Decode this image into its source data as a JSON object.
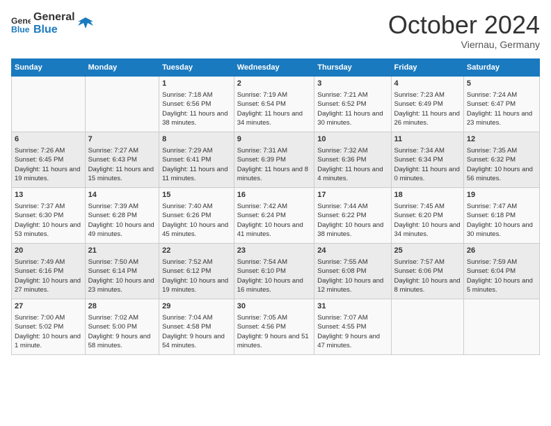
{
  "logo": {
    "line1": "General",
    "line2": "Blue"
  },
  "title": "October 2024",
  "location": "Viernau, Germany",
  "headers": [
    "Sunday",
    "Monday",
    "Tuesday",
    "Wednesday",
    "Thursday",
    "Friday",
    "Saturday"
  ],
  "rows": [
    [
      {
        "day": "",
        "info": ""
      },
      {
        "day": "",
        "info": ""
      },
      {
        "day": "1",
        "info": "Sunrise: 7:18 AM\nSunset: 6:56 PM\nDaylight: 11 hours and 38 minutes."
      },
      {
        "day": "2",
        "info": "Sunrise: 7:19 AM\nSunset: 6:54 PM\nDaylight: 11 hours and 34 minutes."
      },
      {
        "day": "3",
        "info": "Sunrise: 7:21 AM\nSunset: 6:52 PM\nDaylight: 11 hours and 30 minutes."
      },
      {
        "day": "4",
        "info": "Sunrise: 7:23 AM\nSunset: 6:49 PM\nDaylight: 11 hours and 26 minutes."
      },
      {
        "day": "5",
        "info": "Sunrise: 7:24 AM\nSunset: 6:47 PM\nDaylight: 11 hours and 23 minutes."
      }
    ],
    [
      {
        "day": "6",
        "info": "Sunrise: 7:26 AM\nSunset: 6:45 PM\nDaylight: 11 hours and 19 minutes."
      },
      {
        "day": "7",
        "info": "Sunrise: 7:27 AM\nSunset: 6:43 PM\nDaylight: 11 hours and 15 minutes."
      },
      {
        "day": "8",
        "info": "Sunrise: 7:29 AM\nSunset: 6:41 PM\nDaylight: 11 hours and 11 minutes."
      },
      {
        "day": "9",
        "info": "Sunrise: 7:31 AM\nSunset: 6:39 PM\nDaylight: 11 hours and 8 minutes."
      },
      {
        "day": "10",
        "info": "Sunrise: 7:32 AM\nSunset: 6:36 PM\nDaylight: 11 hours and 4 minutes."
      },
      {
        "day": "11",
        "info": "Sunrise: 7:34 AM\nSunset: 6:34 PM\nDaylight: 11 hours and 0 minutes."
      },
      {
        "day": "12",
        "info": "Sunrise: 7:35 AM\nSunset: 6:32 PM\nDaylight: 10 hours and 56 minutes."
      }
    ],
    [
      {
        "day": "13",
        "info": "Sunrise: 7:37 AM\nSunset: 6:30 PM\nDaylight: 10 hours and 53 minutes."
      },
      {
        "day": "14",
        "info": "Sunrise: 7:39 AM\nSunset: 6:28 PM\nDaylight: 10 hours and 49 minutes."
      },
      {
        "day": "15",
        "info": "Sunrise: 7:40 AM\nSunset: 6:26 PM\nDaylight: 10 hours and 45 minutes."
      },
      {
        "day": "16",
        "info": "Sunrise: 7:42 AM\nSunset: 6:24 PM\nDaylight: 10 hours and 41 minutes."
      },
      {
        "day": "17",
        "info": "Sunrise: 7:44 AM\nSunset: 6:22 PM\nDaylight: 10 hours and 38 minutes."
      },
      {
        "day": "18",
        "info": "Sunrise: 7:45 AM\nSunset: 6:20 PM\nDaylight: 10 hours and 34 minutes."
      },
      {
        "day": "19",
        "info": "Sunrise: 7:47 AM\nSunset: 6:18 PM\nDaylight: 10 hours and 30 minutes."
      }
    ],
    [
      {
        "day": "20",
        "info": "Sunrise: 7:49 AM\nSunset: 6:16 PM\nDaylight: 10 hours and 27 minutes."
      },
      {
        "day": "21",
        "info": "Sunrise: 7:50 AM\nSunset: 6:14 PM\nDaylight: 10 hours and 23 minutes."
      },
      {
        "day": "22",
        "info": "Sunrise: 7:52 AM\nSunset: 6:12 PM\nDaylight: 10 hours and 19 minutes."
      },
      {
        "day": "23",
        "info": "Sunrise: 7:54 AM\nSunset: 6:10 PM\nDaylight: 10 hours and 16 minutes."
      },
      {
        "day": "24",
        "info": "Sunrise: 7:55 AM\nSunset: 6:08 PM\nDaylight: 10 hours and 12 minutes."
      },
      {
        "day": "25",
        "info": "Sunrise: 7:57 AM\nSunset: 6:06 PM\nDaylight: 10 hours and 8 minutes."
      },
      {
        "day": "26",
        "info": "Sunrise: 7:59 AM\nSunset: 6:04 PM\nDaylight: 10 hours and 5 minutes."
      }
    ],
    [
      {
        "day": "27",
        "info": "Sunrise: 7:00 AM\nSunset: 5:02 PM\nDaylight: 10 hours and 1 minute."
      },
      {
        "day": "28",
        "info": "Sunrise: 7:02 AM\nSunset: 5:00 PM\nDaylight: 9 hours and 58 minutes."
      },
      {
        "day": "29",
        "info": "Sunrise: 7:04 AM\nSunset: 4:58 PM\nDaylight: 9 hours and 54 minutes."
      },
      {
        "day": "30",
        "info": "Sunrise: 7:05 AM\nSunset: 4:56 PM\nDaylight: 9 hours and 51 minutes."
      },
      {
        "day": "31",
        "info": "Sunrise: 7:07 AM\nSunset: 4:55 PM\nDaylight: 9 hours and 47 minutes."
      },
      {
        "day": "",
        "info": ""
      },
      {
        "day": "",
        "info": ""
      }
    ]
  ]
}
